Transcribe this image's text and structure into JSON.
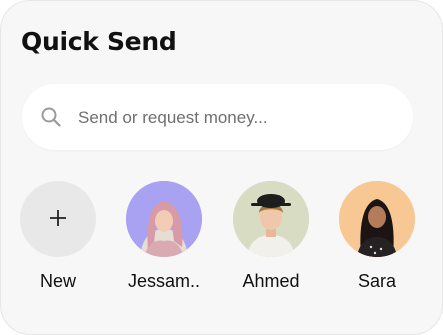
{
  "widget": {
    "title": "Quick Send"
  },
  "search": {
    "placeholder": "Send or request money...",
    "icon": "search-icon"
  },
  "contacts": [
    {
      "name": "New",
      "icon": "plus-icon",
      "bg": "#e8e8e8"
    },
    {
      "name": "Jessam..",
      "bg": "#a9a2f2"
    },
    {
      "name": "Ahmed",
      "bg": "#d7dcc3"
    },
    {
      "name": "Sara",
      "bg": "#f7c894"
    }
  ],
  "colors": {
    "card": "#f7f7f7",
    "title": "#111111"
  }
}
